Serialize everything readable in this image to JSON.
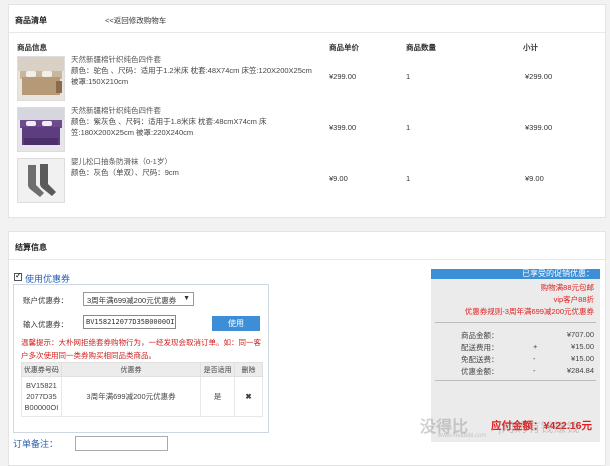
{
  "cart": {
    "title": "商品清单",
    "back_link": "<<返回修改购物车",
    "headers": {
      "info": "商品信息",
      "price": "商品单价",
      "qty": "商品数量",
      "subtotal": "小计"
    },
    "items": [
      {
        "name": "天然新疆棉针织纯色四件套",
        "line2": "颜色：驼色 、尺码：适用于1.2米床 枕套:48X74cm 床笠:120X200X25cm",
        "line3": "被罩:150X210cm",
        "price": "¥299.00",
        "qty": "1",
        "subtotal": "¥299.00"
      },
      {
        "name": "天然新疆棉针织纯色四件套",
        "line2": "颜色：紫灰色 、尺码：适用于1.8米床 枕套:48cmX74cm 床",
        "line3": "笠:180X200X25cm 被罩:220X240cm",
        "price": "¥399.00",
        "qty": "1",
        "subtotal": "¥399.00"
      },
      {
        "name": "婴儿松口抽条防滑袜（0-1岁）",
        "line2": "颜色：灰色（单双）、尺码：9cm",
        "line3": "",
        "price": "¥9.00",
        "qty": "1",
        "subtotal": "¥9.00"
      }
    ]
  },
  "settle": {
    "title": "结算信息",
    "coupon": {
      "toggle_label": "使用优惠券",
      "account_label": "账户优惠券：",
      "account_selected": "3周年满699减200元优惠券",
      "input_label": "输入优惠券：",
      "input_value": "BV158212077D35B0000OI",
      "use_button": "使用",
      "warning": "温馨提示：大朴网拒绝套券购物行为，一经发现会取消订单。如：同一客户多次使用同一类券购买相同品类商品。",
      "table_headers": [
        "优惠券号码",
        "优惠券",
        "是否适用",
        "删除"
      ],
      "table_rows": [
        {
          "code": "BV158212077D35B00000OI",
          "name": "3周年满699减200元优惠券",
          "applicable": "是",
          "delete": "✖"
        }
      ]
    },
    "remark_label": "订单备注："
  },
  "summary": {
    "header": "已享受的促销优惠：",
    "promos": [
      "购物满88元包邮",
      "vip客户88折",
      "优惠券规则-3周年满699减200元优惠券"
    ],
    "rows": [
      {
        "label": "商品金额：",
        "sign": "",
        "value": "¥707.00"
      },
      {
        "label": "配送费用：",
        "sign": "+",
        "value": "¥15.00"
      },
      {
        "label": "免配送费：",
        "sign": "-",
        "value": "¥15.00"
      },
      {
        "label": "优惠金额：",
        "sign": "-",
        "value": "¥284.84"
      }
    ],
    "pay_label": "应付金额：",
    "pay_value": "¥422.16元"
  },
  "watermark": {
    "main": "没得比",
    "site": "www.meidebi.com",
    "right": "|网购有钱赚钱",
    "icon": "logo"
  }
}
